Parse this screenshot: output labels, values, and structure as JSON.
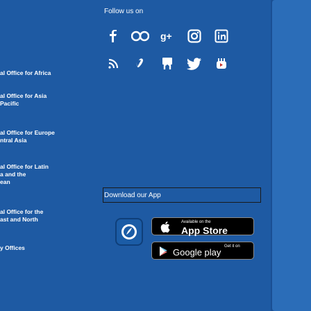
{
  "follow_us": {
    "title": "Follow us on"
  },
  "social_icons_row1": [
    "facebook-icon",
    "flickr-icon",
    "google-plus-icon",
    "instagram-icon",
    "linkedin-icon"
  ],
  "social_icons_row2": [
    "rss-icon",
    "vimeo-icon",
    "slideshare-icon",
    "twitter-icon",
    "youtube-icon"
  ],
  "download": {
    "title": "Download our App"
  },
  "app_store": {
    "top_line": "Available on the",
    "name": "App Store"
  },
  "google_play": {
    "top_line": "Get it on",
    "name": "Google play"
  },
  "offices": [
    {
      "lines": [
        "al Office for Africa"
      ]
    },
    {
      "lines": [
        "al Office for Asia",
        "Pacific"
      ]
    },
    {
      "lines": [
        "al Office for Europe",
        "ntral Asia"
      ]
    },
    {
      "lines": [
        "al Office for Latin",
        "a and the",
        "ean"
      ]
    },
    {
      "lines": [
        "al Office for the",
        "ast and North"
      ]
    },
    {
      "lines": [
        "y Offices"
      ]
    }
  ],
  "colors": {
    "background": "#1e5aa3",
    "panel": "#2b6db8",
    "box_border": "#1a1a1a"
  }
}
